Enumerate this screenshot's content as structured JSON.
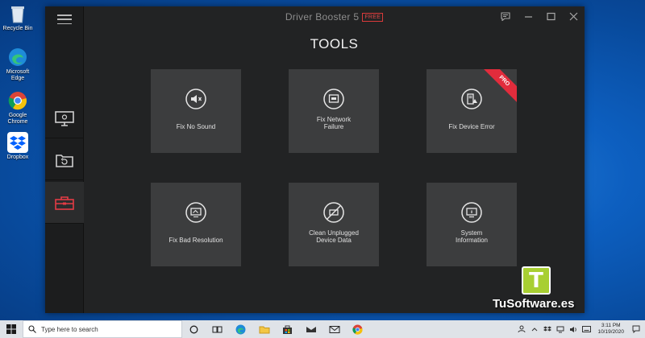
{
  "desktop": {
    "icons": [
      {
        "label": "Recycle Bin",
        "icon": "recycle-bin-icon"
      },
      {
        "label": "Microsoft Edge",
        "icon": "edge-icon"
      },
      {
        "label": "Google Chrome",
        "icon": "chrome-icon"
      },
      {
        "label": "Dropbox",
        "icon": "dropbox-icon"
      }
    ]
  },
  "app": {
    "title": "Driver Booster 5",
    "badge": "FREE",
    "heading": "TOOLS",
    "sidebar": [
      {
        "icon": "monitor-icon",
        "name": "scan"
      },
      {
        "icon": "restore-icon",
        "name": "action-center"
      },
      {
        "icon": "toolbox-icon",
        "name": "tools"
      }
    ],
    "tiles": [
      {
        "label": "Fix No Sound",
        "icon": "speaker-mute-icon"
      },
      {
        "label": "Fix Network\nFailure",
        "icon": "network-icon"
      },
      {
        "label": "Fix Device Error",
        "icon": "device-error-icon",
        "ribbon": "PRO"
      },
      {
        "label": "Fix Bad Resolution",
        "icon": "resolution-icon"
      },
      {
        "label": "Clean Unplugged\nDevice Data",
        "icon": "unplugged-device-icon"
      },
      {
        "label": "System\nInformation",
        "icon": "system-info-icon"
      }
    ]
  },
  "watermark": {
    "letter": "T",
    "text": "TuSoftware.es"
  },
  "taskbar": {
    "search_placeholder": "Type here to search",
    "time": "3:11 PM",
    "date": "10/19/2020"
  },
  "colors": {
    "accent": "#e22c3c",
    "tile": "#3c3d3e",
    "window": "#222324",
    "watermark_green": "#a8cf32"
  }
}
